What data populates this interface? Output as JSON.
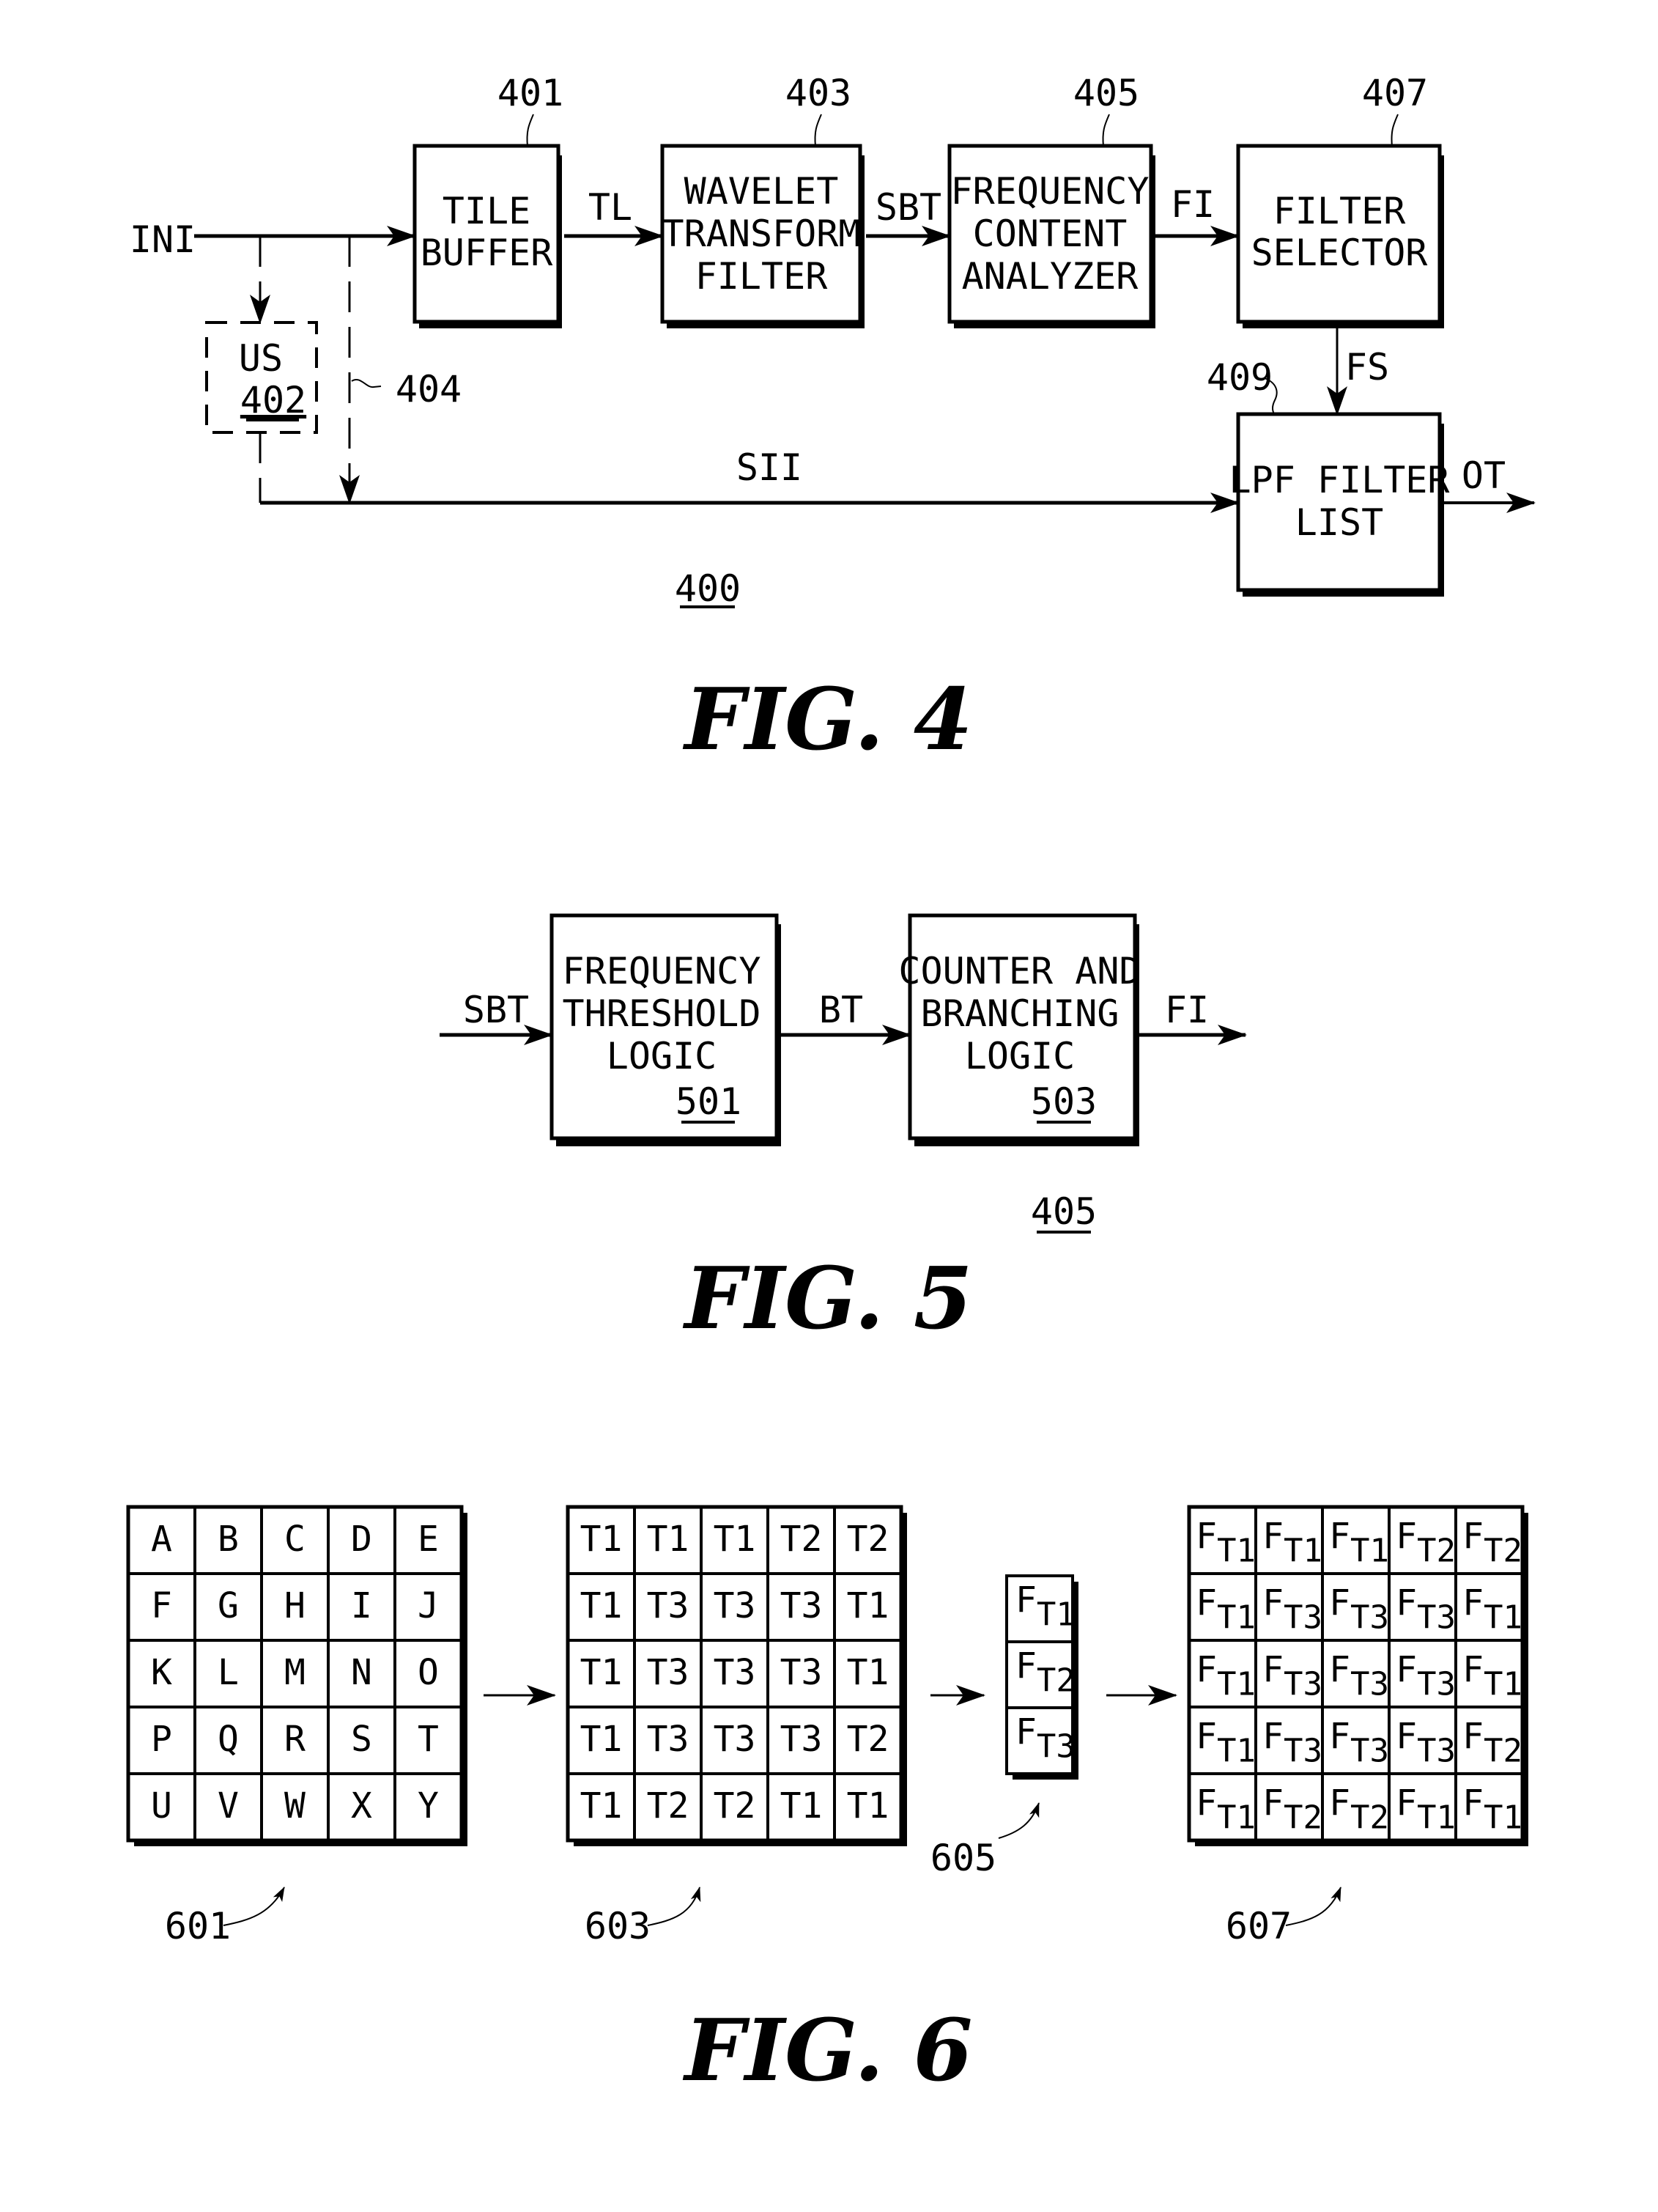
{
  "fig4": {
    "title": "FIG. 4",
    "system_ref": "400",
    "blocks": [
      {
        "id": "401",
        "lines": [
          "TILE",
          "BUFFER"
        ]
      },
      {
        "id": "403",
        "lines": [
          "WAVELET",
          "TRANSFORM",
          "FILTER"
        ]
      },
      {
        "id": "405",
        "lines": [
          "FREQUENCY",
          "CONTENT",
          "ANALYZER"
        ]
      },
      {
        "id": "407",
        "lines": [
          "FILTER",
          "SELECTOR"
        ]
      },
      {
        "id": "409",
        "lines": [
          "LPF FILTER",
          "LIST"
        ]
      }
    ],
    "optional_block": {
      "label": "US",
      "ref": "402"
    },
    "bypass_ref": "404",
    "signals": {
      "input": "INI",
      "tl": "TL",
      "sbt": "SBT",
      "fi": "FI",
      "fs": "FS",
      "sii": "SII",
      "ot": "OT"
    }
  },
  "fig5": {
    "title": "FIG. 5",
    "system_ref": "405",
    "blocks": [
      {
        "id": "501",
        "lines": [
          "FREQUENCY",
          "THRESHOLD",
          "LOGIC"
        ]
      },
      {
        "id": "503",
        "lines": [
          "COUNTER AND",
          "BRANCHING",
          "LOGIC"
        ]
      }
    ],
    "signals": {
      "input": "SBT",
      "bt": "BT",
      "output": "FI"
    }
  },
  "fig6": {
    "title": "FIG. 6",
    "grid601": {
      "ref": "601",
      "rows": [
        [
          "A",
          "B",
          "C",
          "D",
          "E"
        ],
        [
          "F",
          "G",
          "H",
          "I",
          "J"
        ],
        [
          "K",
          "L",
          "M",
          "N",
          "O"
        ],
        [
          "P",
          "Q",
          "R",
          "S",
          "T"
        ],
        [
          "U",
          "V",
          "W",
          "X",
          "Y"
        ]
      ]
    },
    "grid603": {
      "ref": "603",
      "rows": [
        [
          "T1",
          "T1",
          "T1",
          "T2",
          "T2"
        ],
        [
          "T1",
          "T3",
          "T3",
          "T3",
          "T1"
        ],
        [
          "T1",
          "T3",
          "T3",
          "T3",
          "T1"
        ],
        [
          "T1",
          "T3",
          "T3",
          "T3",
          "T2"
        ],
        [
          "T1",
          "T2",
          "T2",
          "T1",
          "T1"
        ]
      ]
    },
    "list605": {
      "ref": "605",
      "items": [
        "T1",
        "T2",
        "T3"
      ],
      "prefix": "F"
    },
    "grid607": {
      "ref": "607",
      "prefix": "F",
      "rows": [
        [
          "T1",
          "T1",
          "T1",
          "T2",
          "T2"
        ],
        [
          "T1",
          "T3",
          "T3",
          "T3",
          "T1"
        ],
        [
          "T1",
          "T3",
          "T3",
          "T3",
          "T1"
        ],
        [
          "T1",
          "T3",
          "T3",
          "T3",
          "T2"
        ],
        [
          "T1",
          "T2",
          "T2",
          "T1",
          "T1"
        ]
      ]
    }
  }
}
